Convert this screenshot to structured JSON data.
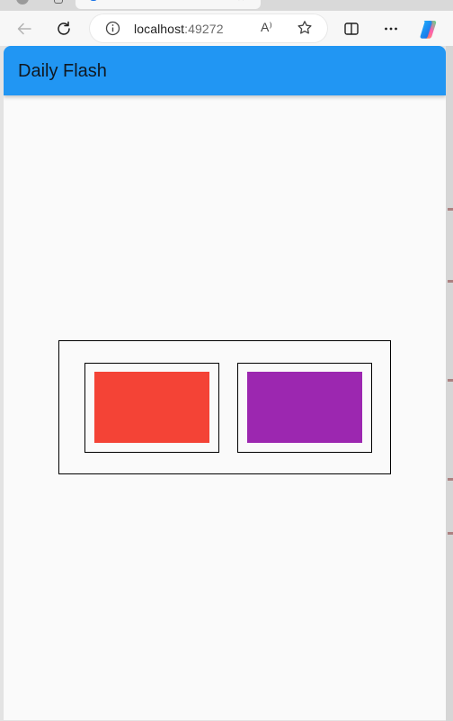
{
  "browser": {
    "address": {
      "host": "localhost",
      "port": ":49272"
    },
    "icons": {
      "back": "arrow-left-icon",
      "reload": "reload-icon",
      "info": "info-icon",
      "read_aloud": "read-aloud-icon",
      "favorite": "star-icon",
      "split_screen": "split-screen-icon",
      "more": "more-icon",
      "copilot": "copilot-icon"
    },
    "read_aloud_glyph": "A⁾"
  },
  "app": {
    "title": "Daily Flash",
    "colors": {
      "appbar": "#2196f3",
      "background": "#fafafa",
      "card_1": "#f44336",
      "card_2": "#9c27b0"
    }
  }
}
